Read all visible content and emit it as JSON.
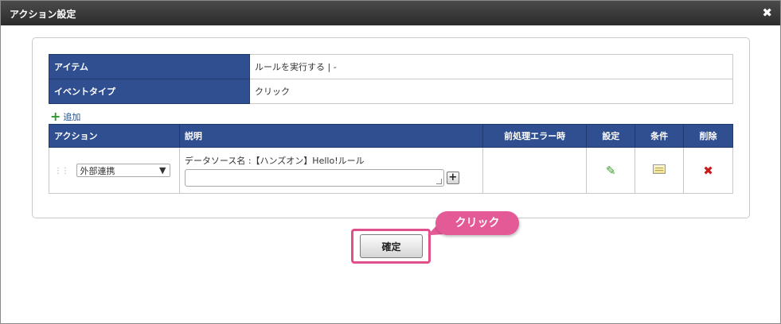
{
  "dialog": {
    "title": "アクション設定",
    "close_symbol": "✖"
  },
  "info": {
    "rows": [
      {
        "label": "アイテム",
        "value": "ルールを実行する | -"
      },
      {
        "label": "イベントタイプ",
        "value": "クリック"
      }
    ]
  },
  "add_link": {
    "icon": "plus-icon",
    "label": "追加"
  },
  "actions_table": {
    "headers": [
      "アクション",
      "説明",
      "前処理エラー時",
      "設定",
      "条件",
      "削除"
    ],
    "rows": [
      {
        "action": "外部連携",
        "description": "データソース名 :【ハンズオン】Hello!ルール",
        "description_input_value": "",
        "pre_error": "",
        "settings_icon": "pencil-icon",
        "condition_icon": "note-icon",
        "delete_icon": "delete-icon"
      }
    ]
  },
  "confirm_button": {
    "label": "確定"
  },
  "callout": {
    "label": "クリック"
  },
  "colors": {
    "header_blue": "#2f4f90",
    "highlight_pink": "#e0508a",
    "add_green": "#2e9a2e",
    "delete_red": "#cc1b1b"
  }
}
